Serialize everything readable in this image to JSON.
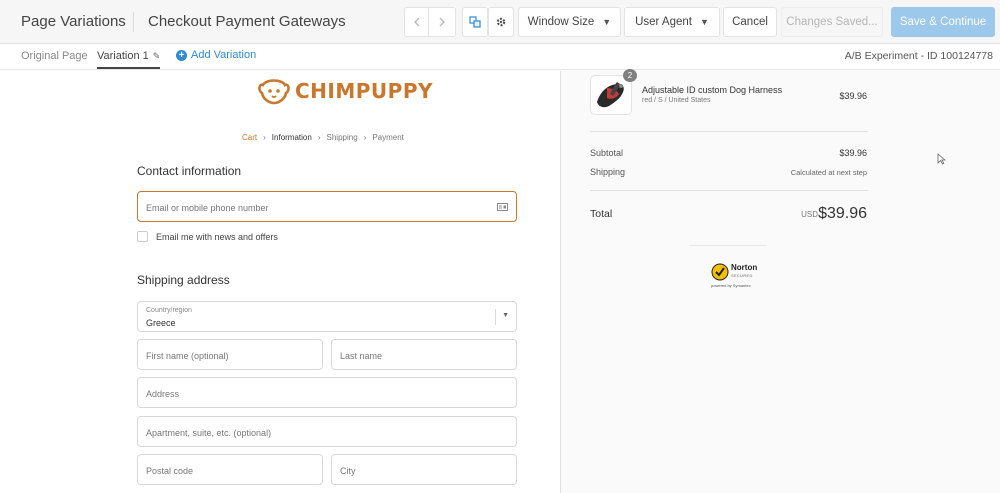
{
  "toolbar": {
    "app_title": "Page Variations",
    "experiment_name": "Checkout Payment Gateways",
    "window_size_label": "Window Size",
    "user_agent_label": "User Agent",
    "cancel_label": "Cancel",
    "changes_label": "Changes Saved...",
    "save_label": "Save & Continue"
  },
  "variation_bar": {
    "original_tab": "Original Page",
    "variation_tab": "Variation 1",
    "add_variation": "Add Variation",
    "experiment_id": "A/B Experiment - ID 100124778"
  },
  "store": {
    "logo_text": "CHIMPUPPY",
    "accent": "#c9772c"
  },
  "breadcrumbs": [
    {
      "label": "Cart"
    },
    {
      "label": "Information"
    },
    {
      "label": "Shipping"
    },
    {
      "label": "Payment"
    }
  ],
  "contact": {
    "heading": "Contact information",
    "email_placeholder": "Email or mobile phone number",
    "newsletter_label": "Email me with news and offers"
  },
  "shipping": {
    "heading": "Shipping address",
    "country_label": "Country/region",
    "country_value": "Greece",
    "first_name_placeholder": "First name (optional)",
    "last_name_placeholder": "Last name",
    "address_placeholder": "Address",
    "apartment_placeholder": "Apartment, suite, etc. (optional)",
    "postal_placeholder": "Postal code",
    "city_placeholder": "City"
  },
  "order": {
    "quantity": "2",
    "product_name": "Adjustable ID custom Dog Harness",
    "product_variant": "red / S / United States",
    "product_price": "$39.96",
    "subtotal_label": "Subtotal",
    "subtotal_value": "$39.96",
    "shipping_label": "Shipping",
    "shipping_value": "Calculated at next step",
    "total_label": "Total",
    "currency": "USD",
    "total_value": "$39.96"
  },
  "norton": {
    "name": "Norton",
    "sub": "SECURED",
    "by": "powered by Symantec"
  }
}
